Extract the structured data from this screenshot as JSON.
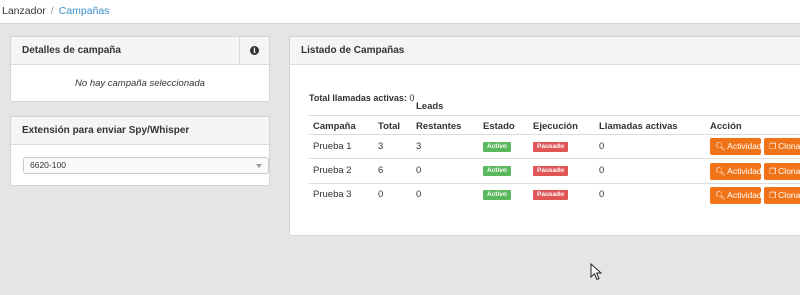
{
  "breadcrumb": {
    "root": "Lanzador",
    "separator": "/",
    "current": "Campañas"
  },
  "details_panel": {
    "title": "Detalles de campaña",
    "empty_message": "No hay campaña seleccionada"
  },
  "extension_panel": {
    "title": "Extensión para enviar Spy/Whisper",
    "select_value": "6620-100"
  },
  "list_panel": {
    "title": "Listado de Campañas",
    "total_label": "Total llamadas activas:",
    "total_value": "0",
    "group_header": "Leads",
    "columns": [
      "Campaña",
      "Total",
      "Restantes",
      "Estado",
      "Ejecución",
      "Llamadas activas",
      "Acción"
    ],
    "rows": [
      {
        "campaign": "Prueba 1",
        "total": "3",
        "remaining": "3",
        "state": "Activo",
        "execution": "Pausado",
        "active_calls": "0"
      },
      {
        "campaign": "Prueba 2",
        "total": "6",
        "remaining": "0",
        "state": "Activo",
        "execution": "Pausado",
        "active_calls": "0"
      },
      {
        "campaign": "Prueba 3",
        "total": "0",
        "remaining": "0",
        "state": "Activo",
        "execution": "Pausado",
        "active_calls": "0"
      }
    ],
    "actions": {
      "activity": "Actividad",
      "clone": "Clonar"
    }
  },
  "colors": {
    "accent_orange": "#f07318",
    "active_green": "#5cb85c",
    "paused_red": "#e05555",
    "link_blue": "#3a8ec8"
  },
  "icons": {
    "info": "info-icon",
    "activity": "search-icon",
    "clone": "copy-icon",
    "select": "chevron-down-icon"
  }
}
